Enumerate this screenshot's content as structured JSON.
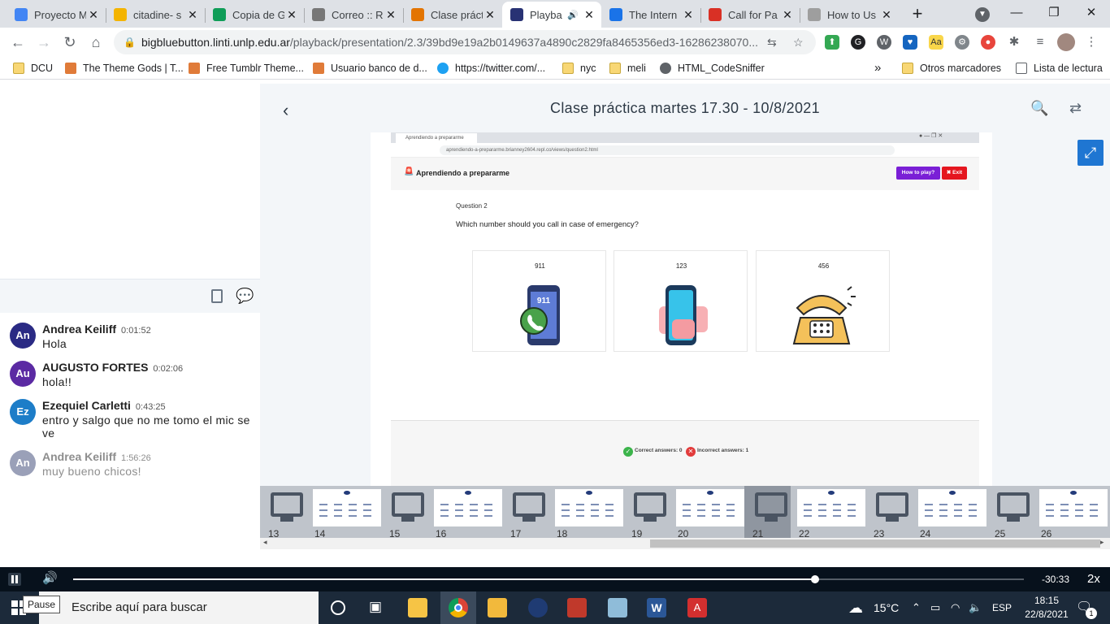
{
  "browser": {
    "tabs": [
      {
        "title": "Proyecto M",
        "fav_color": "#4285f4",
        "active": false
      },
      {
        "title": "citadine- s",
        "fav_color": "#f4b400",
        "active": false
      },
      {
        "title": "Copia de G",
        "fav_color": "#0f9d58",
        "active": false
      },
      {
        "title": "Correo :: R",
        "fav_color": "#777777",
        "active": false
      },
      {
        "title": "Clase práct",
        "fav_color": "#e37400",
        "active": false
      },
      {
        "title": "Playba",
        "fav_color": "#283274",
        "active": true
      },
      {
        "title": "The Intern",
        "fav_color": "#1a73e8",
        "active": false
      },
      {
        "title": "Call for Pa",
        "fav_color": "#d93025",
        "active": false
      },
      {
        "title": "How to Us",
        "fav_color": "#9e9e9e",
        "active": false
      }
    ],
    "address": {
      "host": "bigbluebutton.linti.unlp.edu.ar",
      "path": "/playback/presentation/2.3/39bd9e19a2b0149637a4890c2829fa8465356ed3-16286238070..."
    },
    "bookmarks": [
      {
        "label": "DCU",
        "icon": "folder-icon"
      },
      {
        "label": "The Theme Gods | T...",
        "icon": "site-icon"
      },
      {
        "label": "Free Tumblr Theme...",
        "icon": "site-icon"
      },
      {
        "label": "Usuario banco de d...",
        "icon": "site-icon"
      },
      {
        "label": "https://twitter.com/...",
        "icon": "twitter-icon"
      },
      {
        "label": "nyc",
        "icon": "folder-icon"
      },
      {
        "label": "meli",
        "icon": "folder-icon"
      },
      {
        "label": "HTML_CodeSniffer",
        "icon": "globe-icon"
      }
    ],
    "bookmarks_more": "»",
    "other_bookmarks": "Otros marcadores",
    "reading_list": "Lista de lectura"
  },
  "chat": {
    "messages": [
      {
        "initials": "An",
        "name": "Andrea Keiliff",
        "time": "0:01:52",
        "text": "Hola",
        "color": "#2a2a84",
        "dim": false
      },
      {
        "initials": "Au",
        "name": "AUGUSTO FORTES",
        "time": "0:02:06",
        "text": "hola!!",
        "color": "#5b2aa3",
        "dim": false
      },
      {
        "initials": "Ez",
        "name": "Ezequiel Carletti",
        "time": "0:43:25",
        "text": "entro y salgo que no me tomo el mic se ve",
        "color": "#1d7dc8",
        "dim": false
      },
      {
        "initials": "An",
        "name": "Andrea Keiliff",
        "time": "1:56:26",
        "text": "muy bueno chicos!",
        "color": "#9aa0b8",
        "dim": true
      }
    ]
  },
  "presentation": {
    "title": "Clase práctica martes 17.30 - 10/8/2021",
    "slide": {
      "inner_tab": "Aprendiendo a prepararme",
      "inner_url": "aprendiendo-a-prepararme.brianney2604.repl.co/views/question2.html",
      "app_name": "Aprendiendo a prepararme",
      "how_to_play": "How to play?",
      "exit": "✖ Exit",
      "question_label": "Question 2",
      "question_text": "Which number should you call in case of emergency?",
      "options": [
        "911",
        "123",
        "456"
      ],
      "correct_label": "Correct answers: 0",
      "incorrect_label": "Incorrect answers: 1"
    }
  },
  "thumbnails": [
    {
      "num": "13",
      "kind": "screen"
    },
    {
      "num": "14",
      "kind": "slide"
    },
    {
      "num": "15",
      "kind": "screen"
    },
    {
      "num": "16",
      "kind": "slide"
    },
    {
      "num": "17",
      "kind": "screen"
    },
    {
      "num": "18",
      "kind": "slide"
    },
    {
      "num": "19",
      "kind": "screen"
    },
    {
      "num": "20",
      "kind": "slide"
    },
    {
      "num": "21",
      "kind": "screen",
      "current": true
    },
    {
      "num": "22",
      "kind": "slide"
    },
    {
      "num": "23",
      "kind": "screen"
    },
    {
      "num": "24",
      "kind": "slide"
    },
    {
      "num": "25",
      "kind": "screen"
    },
    {
      "num": "26",
      "kind": "slide"
    }
  ],
  "player": {
    "remaining": "-30:33",
    "speed": "2x",
    "progress_fraction": 0.78,
    "pause_tooltip": "Pause"
  },
  "taskbar": {
    "search_placeholder": "Escribe aquí para buscar",
    "temperature": "15°C",
    "language": "ESP",
    "time": "18:15",
    "date": "22/8/2021",
    "notifications": "1"
  }
}
